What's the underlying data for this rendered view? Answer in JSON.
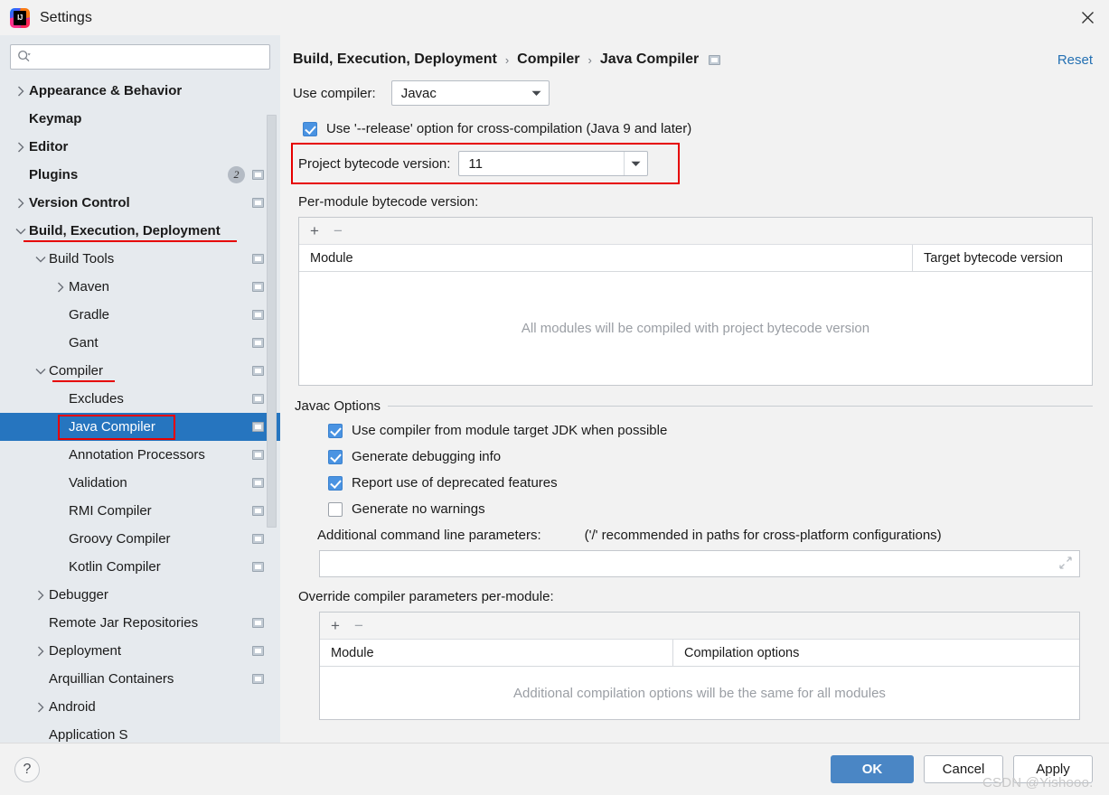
{
  "window": {
    "title": "Settings",
    "logo_icon": "intellij-idea-logo",
    "close_icon": "close-icon"
  },
  "search": {
    "icon": "search-icon",
    "value": "",
    "placeholder": ""
  },
  "sidebar": {
    "items": [
      {
        "label": "Appearance & Behavior",
        "indent": 0,
        "arrow": "chevron-right",
        "bold": true,
        "badge": null,
        "icon": null,
        "selected": false,
        "underline": false
      },
      {
        "label": "Keymap",
        "indent": 0,
        "arrow": "none",
        "bold": true,
        "badge": null,
        "icon": null,
        "selected": false,
        "underline": false
      },
      {
        "label": "Editor",
        "indent": 0,
        "arrow": "chevron-right",
        "bold": true,
        "badge": null,
        "icon": null,
        "selected": false,
        "underline": false
      },
      {
        "label": "Plugins",
        "indent": 0,
        "arrow": "none",
        "bold": true,
        "badge": "2",
        "icon": "settings-sync-icon",
        "selected": false,
        "underline": false
      },
      {
        "label": "Version Control",
        "indent": 0,
        "arrow": "chevron-right",
        "bold": true,
        "badge": null,
        "icon": "settings-sync-icon",
        "selected": false,
        "underline": false
      },
      {
        "label": "Build, Execution, Deployment",
        "indent": 0,
        "arrow": "chevron-down",
        "bold": true,
        "badge": null,
        "icon": null,
        "selected": false,
        "underline": true
      },
      {
        "label": "Build Tools",
        "indent": 1,
        "arrow": "chevron-down",
        "bold": false,
        "badge": null,
        "icon": "settings-sync-icon",
        "selected": false,
        "underline": false
      },
      {
        "label": "Maven",
        "indent": 2,
        "arrow": "chevron-right",
        "bold": false,
        "badge": null,
        "icon": "settings-sync-icon",
        "selected": false,
        "underline": false
      },
      {
        "label": "Gradle",
        "indent": 2,
        "arrow": "none",
        "bold": false,
        "badge": null,
        "icon": "settings-sync-icon",
        "selected": false,
        "underline": false
      },
      {
        "label": "Gant",
        "indent": 2,
        "arrow": "none",
        "bold": false,
        "badge": null,
        "icon": "settings-sync-icon",
        "selected": false,
        "underline": false
      },
      {
        "label": "Compiler",
        "indent": 1,
        "arrow": "chevron-down",
        "bold": false,
        "badge": null,
        "icon": "settings-sync-icon",
        "selected": false,
        "underline": true
      },
      {
        "label": "Excludes",
        "indent": 2,
        "arrow": "none",
        "bold": false,
        "badge": null,
        "icon": "settings-sync-icon",
        "selected": false,
        "underline": false
      },
      {
        "label": "Java Compiler",
        "indent": 2,
        "arrow": "none",
        "bold": false,
        "badge": null,
        "icon": "settings-sync-icon",
        "selected": true,
        "underline": false
      },
      {
        "label": "Annotation Processors",
        "indent": 2,
        "arrow": "none",
        "bold": false,
        "badge": null,
        "icon": "settings-sync-icon",
        "selected": false,
        "underline": false
      },
      {
        "label": "Validation",
        "indent": 2,
        "arrow": "none",
        "bold": false,
        "badge": null,
        "icon": "settings-sync-icon",
        "selected": false,
        "underline": false
      },
      {
        "label": "RMI Compiler",
        "indent": 2,
        "arrow": "none",
        "bold": false,
        "badge": null,
        "icon": "settings-sync-icon",
        "selected": false,
        "underline": false
      },
      {
        "label": "Groovy Compiler",
        "indent": 2,
        "arrow": "none",
        "bold": false,
        "badge": null,
        "icon": "settings-sync-icon",
        "selected": false,
        "underline": false
      },
      {
        "label": "Kotlin Compiler",
        "indent": 2,
        "arrow": "none",
        "bold": false,
        "badge": null,
        "icon": "settings-sync-icon",
        "selected": false,
        "underline": false
      },
      {
        "label": "Debugger",
        "indent": 1,
        "arrow": "chevron-right",
        "bold": false,
        "badge": null,
        "icon": null,
        "selected": false,
        "underline": false
      },
      {
        "label": "Remote Jar Repositories",
        "indent": 1,
        "arrow": "none",
        "bold": false,
        "badge": null,
        "icon": "settings-sync-icon",
        "selected": false,
        "underline": false
      },
      {
        "label": "Deployment",
        "indent": 1,
        "arrow": "chevron-right",
        "bold": false,
        "badge": null,
        "icon": "settings-sync-icon",
        "selected": false,
        "underline": false
      },
      {
        "label": "Arquillian Containers",
        "indent": 1,
        "arrow": "none",
        "bold": false,
        "badge": null,
        "icon": "settings-sync-icon",
        "selected": false,
        "underline": false
      },
      {
        "label": "Android",
        "indent": 1,
        "arrow": "chevron-right",
        "bold": false,
        "badge": null,
        "icon": null,
        "selected": false,
        "underline": false
      },
      {
        "label": "Application S",
        "indent": 1,
        "arrow": "none",
        "bold": false,
        "badge": null,
        "icon": null,
        "selected": false,
        "underline": false
      }
    ]
  },
  "breadcrumb": {
    "parts": [
      "Build, Execution, Deployment",
      "Compiler",
      "Java Compiler"
    ],
    "separator": "›",
    "icon": "settings-sync-icon",
    "reset_label": "Reset"
  },
  "main": {
    "use_compiler_label": "Use compiler:",
    "use_compiler_value": "Javac",
    "release_option": {
      "label": "Use '--release' option for cross-compilation (Java 9 and later)",
      "checked": true
    },
    "project_bytecode": {
      "label": "Project bytecode version:",
      "value": "11"
    },
    "per_module_label": "Per-module bytecode version:",
    "module_table": {
      "add_icon": "plus-icon",
      "remove_icon": "minus-icon",
      "columns": [
        "Module",
        "Target bytecode version"
      ],
      "empty_text": "All modules will be compiled with project bytecode version",
      "rows": []
    },
    "javac_options": {
      "title": "Javac Options",
      "checkboxes": [
        {
          "label": "Use compiler from module target JDK when possible",
          "checked": true
        },
        {
          "label": "Generate debugging info",
          "checked": true
        },
        {
          "label": "Report use of deprecated features",
          "checked": true
        },
        {
          "label": "Generate no warnings",
          "checked": false
        }
      ],
      "additional_params_label": "Additional command line parameters:",
      "additional_params_hint": "('/' recommended in paths for cross-platform configurations)",
      "additional_params_value": "",
      "expand_icon": "expand-icon"
    },
    "override_section": {
      "label": "Override compiler parameters per-module:",
      "add_icon": "plus-icon",
      "remove_icon": "minus-icon",
      "columns": [
        "Module",
        "Compilation options"
      ],
      "empty_text": "Additional compilation options will be the same for all modules",
      "rows": []
    }
  },
  "bottom": {
    "help_icon": "help-icon",
    "ok_label": "OK",
    "cancel_label": "Cancel",
    "apply_label": "Apply",
    "watermark": "CSDN @Yishooo."
  },
  "colors": {
    "selection": "#2675bf",
    "accent": "#4a86c5",
    "annotation_red": "#e60000",
    "link": "#2470b3"
  }
}
